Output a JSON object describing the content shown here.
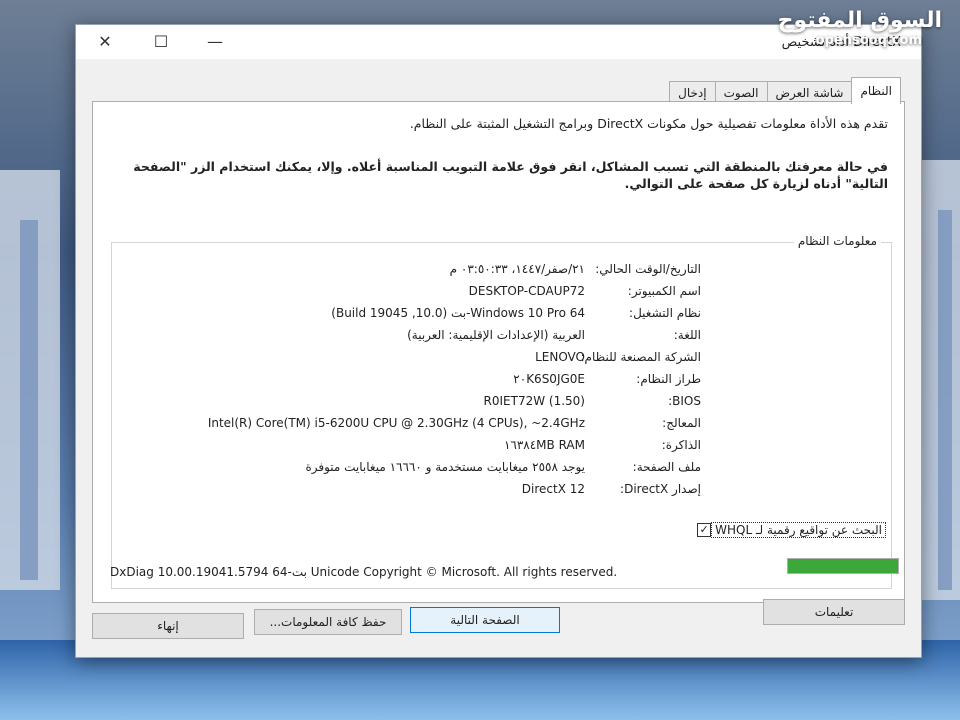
{
  "window": {
    "title": "DirectX أداة تشخيص",
    "controls": {
      "close": "✕",
      "maximize": "☐",
      "minimize": "—"
    }
  },
  "watermark": {
    "arabic": "السوق المفتوح",
    "english": "opensooq.com"
  },
  "tabs": [
    "النظام",
    "شاشة العرض",
    "الصوت",
    "إدخال"
  ],
  "intro": {
    "line1": "تقدم هذه الأداة معلومات تفصيلية حول مكونات DirectX وبرامج التشغيل المثبتة على النظام.",
    "line2": "في حالة معرفتك بالمنطقة التي تسبب المشاكل، انقر فوق علامة التبويب المناسبة أعلاه. وإلا، يمكنك استخدام الزر \"الصفحة التالية\" أدناه لزيارة كل صفحة على التوالي."
  },
  "system_info": {
    "group_label": "معلومات النظام",
    "rows": [
      {
        "label": "التاريخ/الوقت الحالي:",
        "value": "٢١/صفر/١٤٤٧، ٠٣:٥٠:٣٣ م"
      },
      {
        "label": "اسم الكمبيوتر:",
        "value": "DESKTOP-CDAUP72"
      },
      {
        "label": "نظام التشغيل:",
        "value": "Windows 10 Pro 64-بت (10.0, Build 19045)"
      },
      {
        "label": "اللغة:",
        "value": "العربية (الإعدادات الإقليمية: العربية)"
      },
      {
        "label": "الشركة المصنعة للنظام:",
        "value": "LENOVO"
      },
      {
        "label": "طراز النظام:",
        "value": "٢٠K6S0JG0E"
      },
      {
        "label": "BIOS:",
        "value": "R0IET72W (1.50)"
      },
      {
        "label": "المعالج:",
        "value": "Intel(R) Core(TM) i5-6200U CPU @ 2.30GHz (4 CPUs), ~2.4GHz"
      },
      {
        "label": "الذاكرة:",
        "value": "١٦٣٨٤MB RAM"
      },
      {
        "label": "ملف الصفحة:",
        "value": "يوجد ٢٥٥٨ ميغابايت مستخدمة و ١٦٦٦٠ ميغابايت متوفرة"
      },
      {
        "label": "إصدار DirectX:",
        "value": "DirectX 12"
      }
    ]
  },
  "whql": {
    "checked": true,
    "label": "البحث عن تواقيع رقمية لـ WHQL"
  },
  "copyright": "DxDiag 10.00.19041.5794 64-بت Unicode  Copyright © Microsoft. All rights reserved.",
  "progress": {
    "value": 1.0,
    "color": "#3ca83c"
  },
  "buttons": {
    "help": "تعليمات",
    "next_page": "الصفحة التالية",
    "save_all": "حفظ كافة المعلومات...",
    "exit": "إنهاء"
  }
}
